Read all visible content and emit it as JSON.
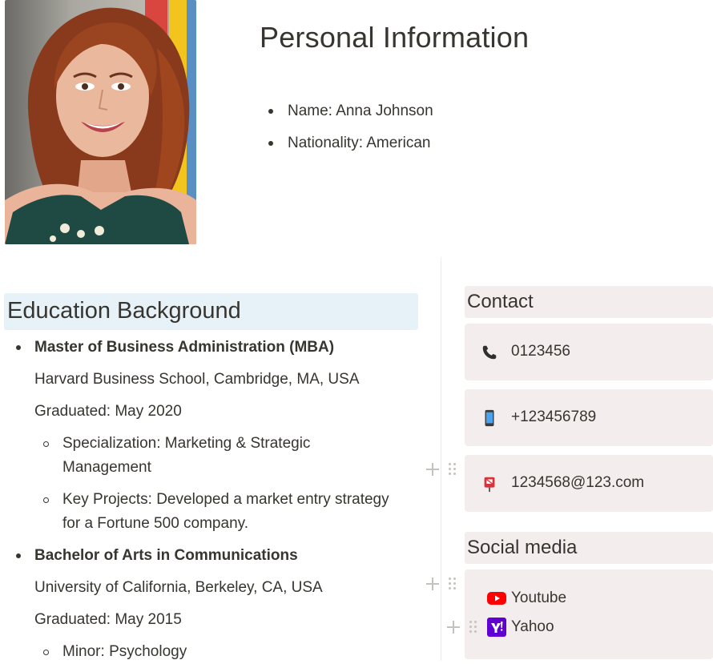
{
  "profile": {
    "photo_alt": "Portrait photo",
    "title": "Personal Information",
    "details": [
      {
        "label": "Name: Anna Johnson"
      },
      {
        "label": "Nationality: American"
      }
    ]
  },
  "education": {
    "heading": "Education Background",
    "degrees": [
      {
        "title": "Master of Business Administration (MBA)",
        "school": "Harvard Business School, Cambridge, MA, USA",
        "graduated": "Graduated: May 2020",
        "sub": [
          {
            "line1": "Specialization: Marketing & Strategic",
            "line2": "Management"
          },
          {
            "line1": "Key Projects: Developed a market entry strategy",
            "line2": "for a Fortune 500 company."
          }
        ]
      },
      {
        "title": "Bachelor of Arts in Communications",
        "school": "University of California, Berkeley, CA, USA",
        "graduated": "Graduated: May 2015",
        "sub": [
          {
            "line1": "Minor: Psychology"
          }
        ]
      }
    ]
  },
  "contact": {
    "heading": "Contact",
    "items": [
      {
        "icon": "telephone-icon",
        "value": "0123456"
      },
      {
        "icon": "mobile-phone-icon",
        "value": "+123456789"
      },
      {
        "icon": "postbox-icon",
        "value": "1234568@123.com"
      }
    ]
  },
  "social": {
    "heading": "Social media",
    "items": [
      {
        "icon": "youtube-icon",
        "label": "Youtube",
        "color": "#ff0000"
      },
      {
        "icon": "yahoo-icon",
        "label": "Yahoo",
        "color": "#6001d2"
      }
    ]
  }
}
